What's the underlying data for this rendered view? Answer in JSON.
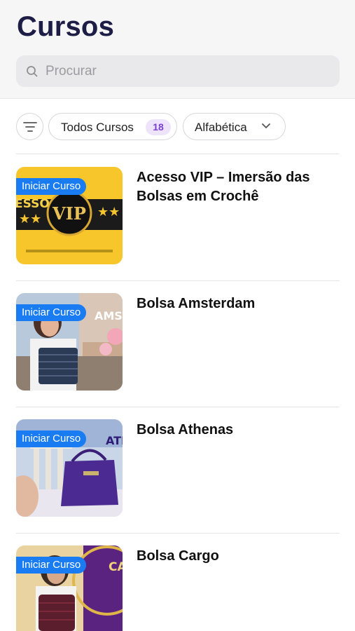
{
  "header": {
    "title": "Cursos"
  },
  "search": {
    "placeholder": "Procurar",
    "icon": "search-icon"
  },
  "filters": {
    "filter_icon": "filter-icon",
    "all_courses_label": "Todos Cursos",
    "all_courses_count": "18",
    "sort_label": "Alfabética",
    "sort_icon": "chevron-down-icon"
  },
  "courses": [
    {
      "title": "Acesso VIP – Imersão das Bolsas em Crochê",
      "badge": "Iniciar Curso",
      "thumb_text": "VIP"
    },
    {
      "title": "Bolsa Amsterdam",
      "badge": "Iniciar Curso",
      "thumb_text": "AMST"
    },
    {
      "title": "Bolsa Athenas",
      "badge": "Iniciar Curso",
      "thumb_text": "ATI"
    },
    {
      "title": "Bolsa Cargo",
      "badge": "Iniciar Curso",
      "thumb_text": "CA"
    }
  ],
  "colors": {
    "title": "#1d1d45",
    "badge": "#1a7cf2",
    "count_badge_bg": "#ede4fb",
    "count_badge_text": "#7b3fd6",
    "header_bg": "#f6f6f7"
  }
}
